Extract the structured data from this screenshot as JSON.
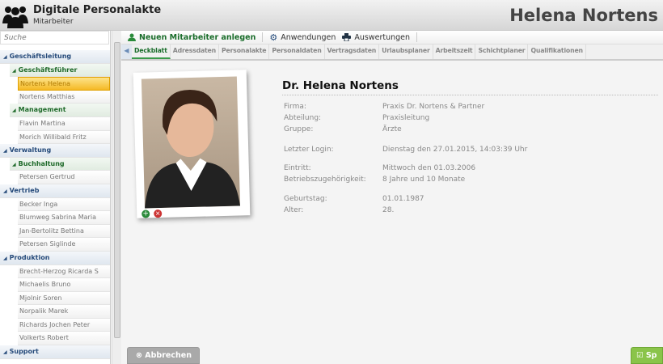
{
  "header": {
    "app_title": "Digitale Personalakte",
    "app_subtitle": "Mitarbeiter",
    "employee_name": "Helena Nortens"
  },
  "sidebar": {
    "search_placeholder": "Suche",
    "tree": [
      {
        "type": "g1",
        "label": "Geschäftsleitung"
      },
      {
        "type": "g2",
        "label": "Geschäftsführer"
      },
      {
        "type": "sel",
        "label": "Nortens Helena"
      },
      {
        "type": "it",
        "label": "Nortens Matthias"
      },
      {
        "type": "g2",
        "label": "Management"
      },
      {
        "type": "it",
        "label": "Flavin Martina"
      },
      {
        "type": "it",
        "label": "Morich Willibald Fritz"
      },
      {
        "type": "g1",
        "label": "Verwaltung"
      },
      {
        "type": "g2",
        "label": "Buchhaltung"
      },
      {
        "type": "it",
        "label": "Petersen Gertrud"
      },
      {
        "type": "g1",
        "label": "Vertrieb"
      },
      {
        "type": "it",
        "label": "Becker Inga"
      },
      {
        "type": "it",
        "label": "Blumweg Sabrina Maria"
      },
      {
        "type": "it",
        "label": "Jan-Bertolitz Bettina"
      },
      {
        "type": "it",
        "label": "Petersen Siglinde"
      },
      {
        "type": "g1",
        "label": "Produktion"
      },
      {
        "type": "it",
        "label": "Brecht-Herzog Ricarda S"
      },
      {
        "type": "it",
        "label": "Michaelis Bruno"
      },
      {
        "type": "it",
        "label": "Mjolnir Soren"
      },
      {
        "type": "it",
        "label": "Norpalik Marek"
      },
      {
        "type": "it",
        "label": "Richards Jochen Peter"
      },
      {
        "type": "it",
        "label": "Volkerts Robert"
      },
      {
        "type": "g1",
        "label": "Support"
      }
    ]
  },
  "toolbar": {
    "new_employee": "Neuen Mitarbeiter anlegen",
    "applications": "Anwendungen",
    "reports": "Auswertungen"
  },
  "tabs": [
    "Deckblatt",
    "Adressdaten",
    "Personalakte",
    "Personaldaten",
    "Vertragsdaten",
    "Urlaubsplaner",
    "Arbeitszeit",
    "Schichtplaner",
    "Qualifikationen"
  ],
  "profile": {
    "name": "Dr. Helena Nortens",
    "fields": [
      {
        "label": "Firma:",
        "value": "Praxis Dr. Nortens & Partner"
      },
      {
        "label": "Abteilung:",
        "value": "Praxisleitung"
      },
      {
        "label": "Gruppe:",
        "value": "Ärzte"
      },
      {
        "label": "Letzter Login:",
        "value": "Dienstag den 27.01.2015, 14:03:39 Uhr"
      },
      {
        "label": "Eintritt:",
        "value": "Mittwoch den 01.03.2006"
      },
      {
        "label": "Betriebszugehörigkeit:",
        "value": "8 Jahre und 10 Monate"
      },
      {
        "label": "Geburtstag:",
        "value": "01.01.1987"
      },
      {
        "label": "Alter:",
        "value": "28."
      }
    ]
  },
  "footer": {
    "cancel": "Abbrechen",
    "save": "Sp"
  },
  "colors": {
    "accent_green": "#1a6d2b",
    "selected": "#f5b925",
    "save_green": "#8ac44a"
  }
}
